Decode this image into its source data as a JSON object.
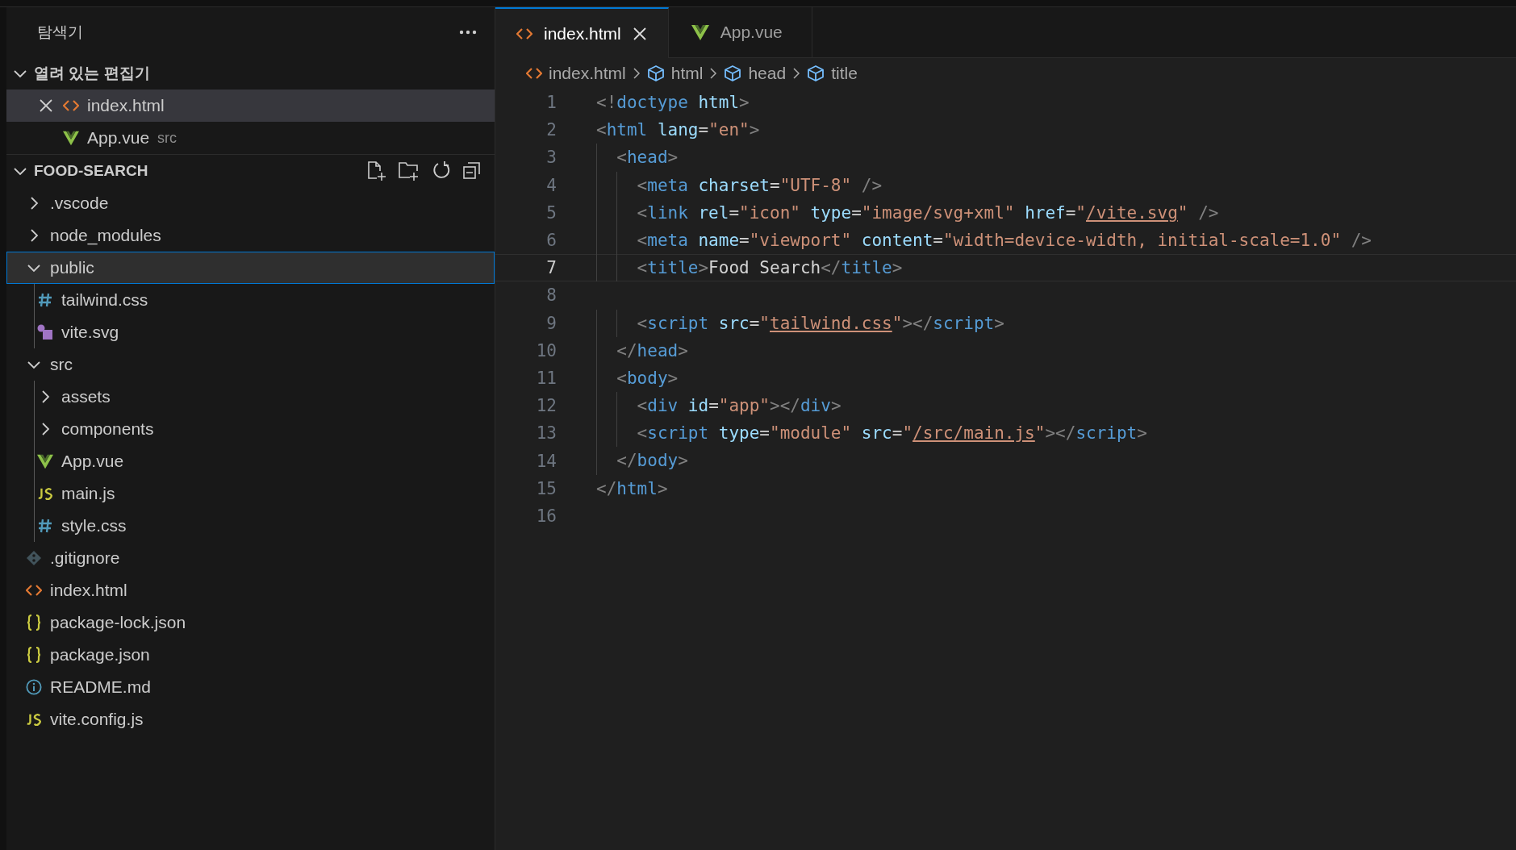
{
  "sidebar": {
    "title": "탐색기",
    "open_editors": {
      "label": "열려 있는 편집기",
      "expanded": true,
      "items": [
        {
          "name": "index.html",
          "kind": "html",
          "selected": true
        },
        {
          "name": "App.vue",
          "kind": "vue",
          "selected": false,
          "description": "src"
        }
      ]
    },
    "project": {
      "label": "FOOD-SEARCH",
      "expanded": true,
      "tree": [
        {
          "name": ".vscode",
          "kind": "folder",
          "expanded": false,
          "selected": false
        },
        {
          "name": "node_modules",
          "kind": "folder",
          "expanded": false,
          "selected": false
        },
        {
          "name": "public",
          "kind": "folder",
          "expanded": true,
          "selected": true,
          "children": [
            {
              "name": "tailwind.css",
              "kind": "css",
              "selected": false
            },
            {
              "name": "vite.svg",
              "kind": "svg",
              "selected": false
            }
          ]
        },
        {
          "name": "src",
          "kind": "folder",
          "expanded": true,
          "selected": false,
          "children": [
            {
              "name": "assets",
              "kind": "folder",
              "expanded": false,
              "selected": false
            },
            {
              "name": "components",
              "kind": "folder",
              "expanded": false,
              "selected": false
            },
            {
              "name": "App.vue",
              "kind": "vue",
              "selected": false
            },
            {
              "name": "main.js",
              "kind": "js",
              "selected": false
            },
            {
              "name": "style.css",
              "kind": "css",
              "selected": false
            }
          ]
        },
        {
          "name": ".gitignore",
          "kind": "git",
          "selected": false
        },
        {
          "name": "index.html",
          "kind": "html",
          "selected": false
        },
        {
          "name": "package-lock.json",
          "kind": "json",
          "selected": false
        },
        {
          "name": "package.json",
          "kind": "json",
          "selected": false
        },
        {
          "name": "README.md",
          "kind": "info",
          "selected": false
        },
        {
          "name": "vite.config.js",
          "kind": "js",
          "selected": false
        }
      ]
    }
  },
  "tabs": [
    {
      "label": "index.html",
      "kind": "html",
      "selected": true
    },
    {
      "label": "App.vue",
      "kind": "vue",
      "selected": false
    }
  ],
  "breadcrumbs": [
    {
      "label": "index.html",
      "kind": "html"
    },
    {
      "label": "html",
      "kind": "element"
    },
    {
      "label": "head",
      "kind": "element"
    },
    {
      "label": "title",
      "kind": "element"
    }
  ],
  "editor": {
    "lines": [
      {
        "number": "1",
        "current": false,
        "text": "<!doctype html>"
      },
      {
        "number": "2",
        "current": false,
        "text": "<html lang=\"en\">"
      },
      {
        "number": "3",
        "current": false,
        "text": "  <head>"
      },
      {
        "number": "4",
        "current": false,
        "text": "    <meta charset=\"UTF-8\" />"
      },
      {
        "number": "5",
        "current": false,
        "text": "    <link rel=\"icon\" type=\"image/svg+xml\" href=\"/vite.svg\" />"
      },
      {
        "number": "6",
        "current": false,
        "text": "    <meta name=\"viewport\" content=\"width=device-width, initial-scale=1.0\" />"
      },
      {
        "number": "7",
        "current": true,
        "text": "    <title>Food Search</title>"
      },
      {
        "number": "8",
        "current": false
      },
      {
        "number": "9",
        "current": false,
        "text": "    <script src=\"tailwind.css\"></script>"
      },
      {
        "number": "10",
        "current": false,
        "text": "  </head>"
      },
      {
        "number": "11",
        "current": false,
        "text": "  <body>"
      },
      {
        "number": "12",
        "current": false,
        "text": "    <div id=\"app\"></div>"
      },
      {
        "number": "13",
        "current": false,
        "text": "    <script type=\"module\" src=\"/src/main.js\"></script>"
      },
      {
        "number": "14",
        "current": false,
        "text": "  </body>"
      },
      {
        "number": "15",
        "current": false,
        "text": "</html>"
      },
      {
        "number": "16",
        "current": false
      }
    ]
  }
}
